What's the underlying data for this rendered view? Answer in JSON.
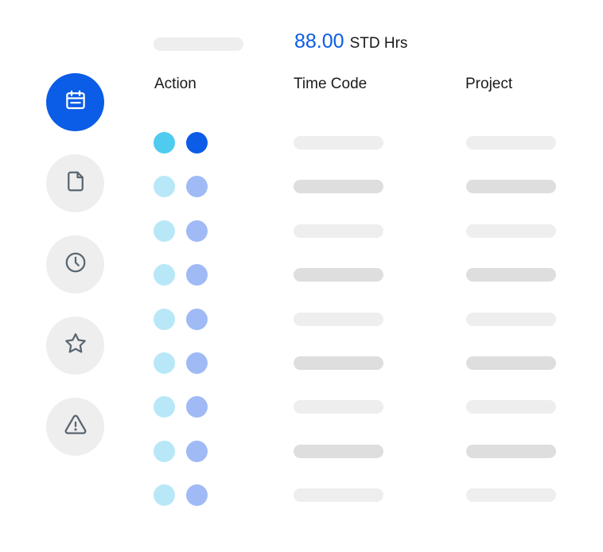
{
  "hours": {
    "value": "88.00",
    "unit": "STD Hrs"
  },
  "columns": {
    "action": "Action",
    "time_code": "Time Code",
    "project": "Project"
  },
  "sidebar": {
    "items": [
      {
        "icon": "calendar-icon",
        "active": true
      },
      {
        "icon": "document-icon",
        "active": false
      },
      {
        "icon": "clock-icon",
        "active": false
      },
      {
        "icon": "star-icon",
        "active": false
      },
      {
        "icon": "warning-icon",
        "active": false
      }
    ]
  },
  "rows_count": 9,
  "colors": {
    "accent": "#0b5ce6",
    "light_cyan": "#b8e8f8",
    "cyan": "#4ecbef",
    "light_blue": "#9fbaf5"
  }
}
